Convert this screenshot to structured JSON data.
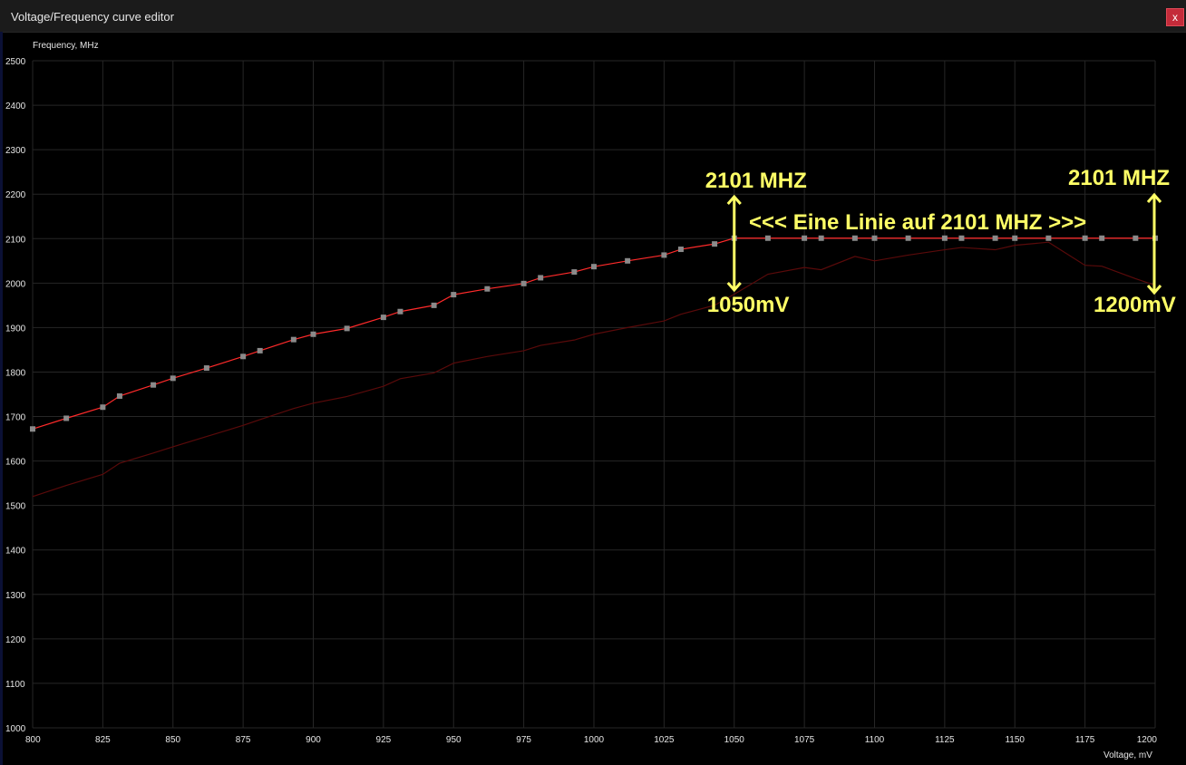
{
  "window": {
    "title": "Voltage/Frequency curve editor",
    "close_label": "x"
  },
  "colors": {
    "curve": "#ff2a2a",
    "base_curve": "#5a0a0a",
    "point": "#8a8a8a",
    "grid": "#262626",
    "annotation": "#ffff66"
  },
  "chart_data": {
    "type": "line",
    "xlabel": "Voltage, mV",
    "ylabel": "Frequency, MHz",
    "xlim": [
      800,
      1200
    ],
    "ylim": [
      1000,
      2500
    ],
    "x_ticks": [
      800,
      825,
      850,
      875,
      900,
      925,
      950,
      975,
      1000,
      1025,
      1050,
      1075,
      1100,
      1125,
      1150,
      1175,
      1200
    ],
    "y_ticks": [
      1000,
      1100,
      1200,
      1300,
      1400,
      1500,
      1600,
      1700,
      1800,
      1900,
      2000,
      2100,
      2200,
      2300,
      2400,
      2500
    ],
    "grid": true,
    "series": [
      {
        "x": [
          800,
          812,
          825,
          831,
          843,
          850,
          862,
          875,
          881,
          893,
          900,
          912,
          925,
          931,
          943,
          950,
          962,
          975,
          981,
          993,
          1000,
          1012,
          1025,
          1031,
          1043,
          1050,
          1062,
          1075,
          1081,
          1093,
          1100,
          1112,
          1125,
          1131,
          1143,
          1150,
          1162,
          1175,
          1181,
          1193,
          1200
        ],
        "values": [
          1672,
          1696,
          1721,
          1746,
          1771,
          1786,
          1809,
          1835,
          1848,
          1873,
          1885,
          1898,
          1923,
          1936,
          1950,
          1974,
          1987,
          1999,
          2012,
          2025,
          2037,
          2050,
          2063,
          2076,
          2088,
          2101,
          2101,
          2101,
          2101,
          2101,
          2101,
          2101,
          2101,
          2101,
          2101,
          2101,
          2101,
          2101,
          2101,
          2101,
          2101
        ]
      },
      {
        "x": [
          800,
          812,
          825,
          831,
          843,
          850,
          862,
          875,
          881,
          893,
          900,
          912,
          925,
          931,
          943,
          950,
          962,
          975,
          981,
          993,
          1000,
          1012,
          1025,
          1031,
          1043,
          1050,
          1062,
          1075,
          1081,
          1093,
          1100,
          1112,
          1125,
          1131,
          1143,
          1150,
          1162,
          1175,
          1181,
          1193,
          1200
        ],
        "values": [
          1520,
          1545,
          1570,
          1595,
          1618,
          1632,
          1655,
          1680,
          1693,
          1718,
          1730,
          1745,
          1768,
          1785,
          1798,
          1820,
          1835,
          1848,
          1860,
          1872,
          1885,
          1900,
          1915,
          1930,
          1950,
          1975,
          2020,
          2035,
          2030,
          2060,
          2050,
          2063,
          2075,
          2080,
          2075,
          2085,
          2092,
          2040,
          2038,
          2010,
          1995
        ]
      }
    ],
    "annotations": [
      {
        "text": "2101 MHZ",
        "x": 1050,
        "y": 2101
      },
      {
        "text": "1050mV",
        "x": 1050,
        "y": 2101
      },
      {
        "text": "<<< Eine Linie auf 2101 MHZ >>>",
        "x": 1125,
        "y": 2101
      },
      {
        "text": "2101 MHZ",
        "x": 1200,
        "y": 2101
      },
      {
        "text": "1200mV",
        "x": 1200,
        "y": 2101
      }
    ]
  }
}
